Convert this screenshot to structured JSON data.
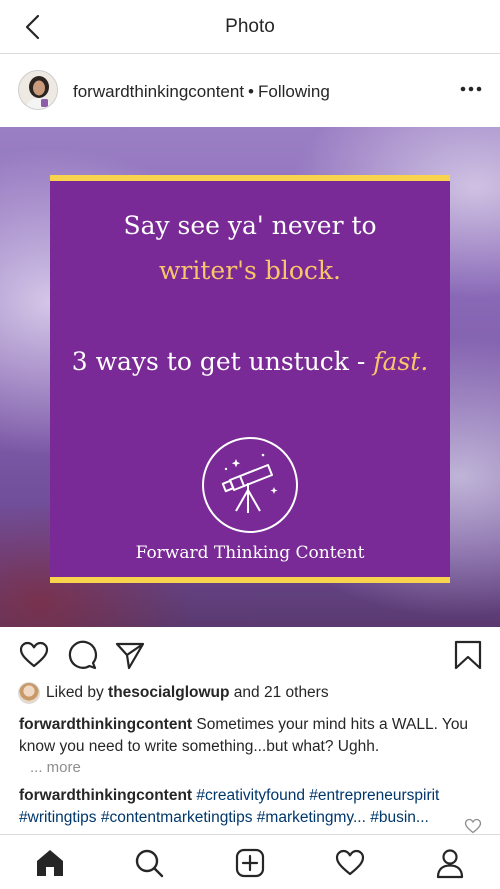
{
  "topbar": {
    "title": "Photo"
  },
  "post": {
    "username": "forwardthinkingcontent",
    "separator": "•",
    "follow_status": "Following"
  },
  "image": {
    "line1": "Say see ya' never to",
    "line2": "writer's block.",
    "line3_main": "3 ways to get unstuck - ",
    "line3_emph": "fast.",
    "brand": "Forward Thinking Content",
    "colors": {
      "card": "#7a2a96",
      "accent": "#f7d34e",
      "highlight_text": "#f7c66b"
    }
  },
  "likes": {
    "prefix": "Liked by",
    "user": "thesocialglowup",
    "suffix": "and 21 others"
  },
  "caption": {
    "username": "forwardthinkingcontent",
    "text": "Sometimes your mind hits a WALL. You know you need to write something...but what? Ughh.",
    "more": "... more"
  },
  "comment": {
    "username": "forwardthinkingcontent",
    "tags": [
      "#creativityfound",
      "#entrepreneurspirit",
      "#writingtips",
      "#contentmarketingtips"
    ],
    "tags_partial": "#marketingmy... #busin..."
  },
  "icons": {
    "back": "chevron-left-icon",
    "more": "more-dots-icon",
    "like": "heart-icon",
    "comment": "comment-icon",
    "share": "send-icon",
    "save": "bookmark-icon",
    "home": "home-icon",
    "search": "search-icon",
    "add": "add-post-icon",
    "activity": "heart-icon",
    "profile": "profile-icon"
  }
}
